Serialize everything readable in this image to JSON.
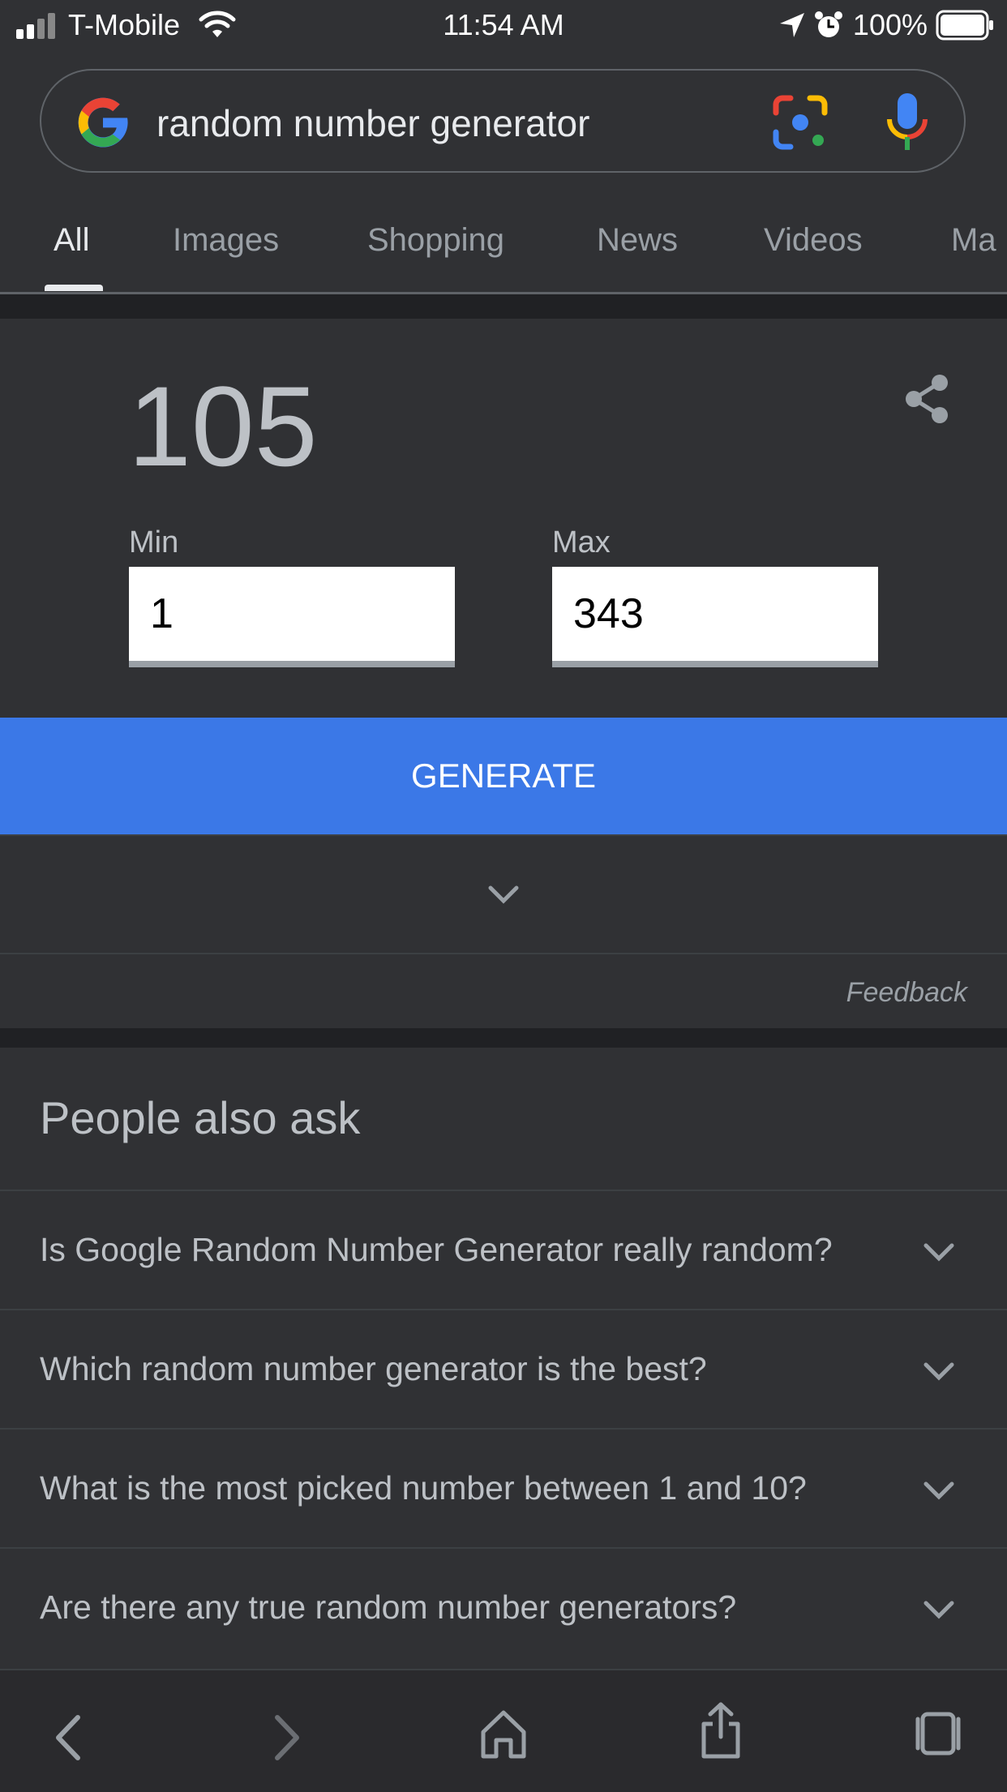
{
  "status_bar": {
    "carrier": "T-Mobile",
    "time": "11:54 AM",
    "battery": "100%"
  },
  "search": {
    "query": "random number generator"
  },
  "tabs": [
    {
      "label": "All"
    },
    {
      "label": "Images"
    },
    {
      "label": "Shopping"
    },
    {
      "label": "News"
    },
    {
      "label": "Videos"
    },
    {
      "label": "Ma"
    }
  ],
  "rng": {
    "result": "105",
    "min_label": "Min",
    "min_value": "1",
    "max_label": "Max",
    "max_value": "343",
    "generate_label": "GENERATE",
    "feedback_label": "Feedback"
  },
  "people_also_ask": {
    "title": "People also ask",
    "questions": [
      "Is Google Random Number Generator really random?",
      "Which random number generator is the best?",
      "What is the most picked number between 1 and 10?",
      "Are there any true random number generators?"
    ]
  },
  "colors": {
    "accent": "#3b78e7",
    "background": "#303134"
  }
}
